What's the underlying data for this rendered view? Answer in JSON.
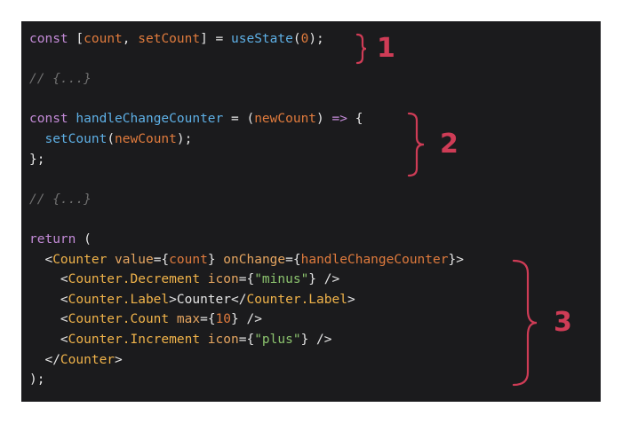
{
  "colors": {
    "background": "#1b1b1d",
    "keyword": "#c48bd8",
    "identifier": "#e07b3d",
    "function": "#5eb0e6",
    "tag": "#f0b34a",
    "attribute": "#e5a560",
    "string": "#8cc36e",
    "number": "#e07b3d",
    "comment": "#6f6f6f",
    "plain": "#e5e5e5",
    "annotation": "#cf3c56"
  },
  "code_lines": [
    [
      [
        "keyword",
        "const"
      ],
      [
        "plain",
        " ["
      ],
      [
        "identifier",
        "count"
      ],
      [
        "plain",
        ", "
      ],
      [
        "identifier",
        "setCount"
      ],
      [
        "plain",
        "] = "
      ],
      [
        "function",
        "useState"
      ],
      [
        "plain",
        "("
      ],
      [
        "number",
        "0"
      ],
      [
        "plain",
        ");"
      ]
    ],
    [],
    [
      [
        "comment",
        "// {...}"
      ]
    ],
    [],
    [
      [
        "keyword",
        "const"
      ],
      [
        "plain",
        " "
      ],
      [
        "function",
        "handleChangeCounter"
      ],
      [
        "plain",
        " = ("
      ],
      [
        "identifier",
        "newCount"
      ],
      [
        "plain",
        ") "
      ],
      [
        "keyword",
        "=>"
      ],
      [
        "plain",
        " {"
      ]
    ],
    [
      [
        "plain",
        "  "
      ],
      [
        "function",
        "setCount"
      ],
      [
        "plain",
        "("
      ],
      [
        "identifier",
        "newCount"
      ],
      [
        "plain",
        ");"
      ]
    ],
    [
      [
        "plain",
        "};"
      ]
    ],
    [],
    [
      [
        "comment",
        "// {...}"
      ]
    ],
    [],
    [
      [
        "keyword",
        "return"
      ],
      [
        "plain",
        " ("
      ]
    ],
    [
      [
        "plain",
        "  <"
      ],
      [
        "tag",
        "Counter"
      ],
      [
        "plain",
        " "
      ],
      [
        "attribute",
        "value"
      ],
      [
        "plain",
        "={"
      ],
      [
        "identifier",
        "count"
      ],
      [
        "plain",
        "} "
      ],
      [
        "attribute",
        "onChange"
      ],
      [
        "plain",
        "={"
      ],
      [
        "identifier",
        "handleChangeCounter"
      ],
      [
        "plain",
        "}>"
      ]
    ],
    [
      [
        "plain",
        "    <"
      ],
      [
        "tag",
        "Counter.Decrement"
      ],
      [
        "plain",
        " "
      ],
      [
        "attribute",
        "icon"
      ],
      [
        "plain",
        "={"
      ],
      [
        "string",
        "\"minus\""
      ],
      [
        "plain",
        "} />"
      ]
    ],
    [
      [
        "plain",
        "    <"
      ],
      [
        "tag",
        "Counter.Label"
      ],
      [
        "plain",
        ">Counter</"
      ],
      [
        "tag",
        "Counter.Label"
      ],
      [
        "plain",
        ">"
      ]
    ],
    [
      [
        "plain",
        "    <"
      ],
      [
        "tag",
        "Counter.Count"
      ],
      [
        "plain",
        " "
      ],
      [
        "attribute",
        "max"
      ],
      [
        "plain",
        "={"
      ],
      [
        "number",
        "10"
      ],
      [
        "plain",
        "} />"
      ]
    ],
    [
      [
        "plain",
        "    <"
      ],
      [
        "tag",
        "Counter.Increment"
      ],
      [
        "plain",
        " "
      ],
      [
        "attribute",
        "icon"
      ],
      [
        "plain",
        "={"
      ],
      [
        "string",
        "\"plus\""
      ],
      [
        "plain",
        "} />"
      ]
    ],
    [
      [
        "plain",
        "  </"
      ],
      [
        "tag",
        "Counter"
      ],
      [
        "plain",
        ">"
      ]
    ],
    [
      [
        "plain",
        ");"
      ]
    ]
  ],
  "annotations": [
    {
      "label": "1"
    },
    {
      "label": "2"
    },
    {
      "label": "3"
    }
  ]
}
